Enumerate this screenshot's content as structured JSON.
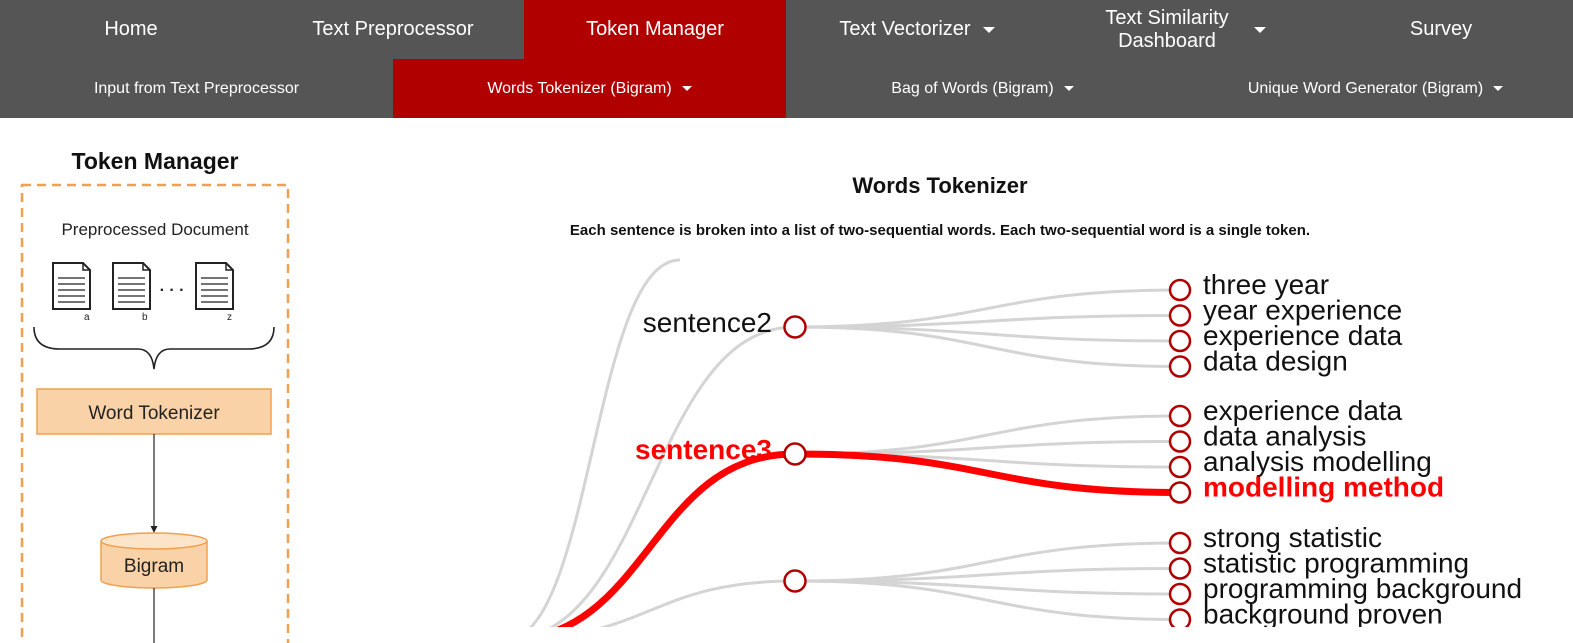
{
  "topnav": [
    {
      "label": "Home",
      "dropdown": false,
      "active": false
    },
    {
      "label": "Text Preprocessor",
      "dropdown": false,
      "active": false
    },
    {
      "label": "Token Manager",
      "dropdown": false,
      "active": true
    },
    {
      "label": "Text Vectorizer",
      "dropdown": true,
      "active": false
    },
    {
      "label": "Text Similarity Dashboard",
      "dropdown": true,
      "active": false
    },
    {
      "label": "Survey",
      "dropdown": false,
      "active": false
    }
  ],
  "subnav": [
    {
      "label": "Input from Text Preprocessor",
      "dropdown": false,
      "active": false
    },
    {
      "label": "Words Tokenizer (Bigram)",
      "dropdown": true,
      "active": true
    },
    {
      "label": "Bag of Words (Bigram)",
      "dropdown": true,
      "active": false
    },
    {
      "label": "Unique Word Generator (Bigram)",
      "dropdown": true,
      "active": false
    }
  ],
  "sidebar": {
    "title": "Token Manager",
    "doc_label": "Preprocessed Document",
    "doc_letters": [
      "a",
      "b",
      "z"
    ],
    "ellipsis": "· · ·",
    "step_label": "Word Tokenizer",
    "store_label": "Bigram"
  },
  "main": {
    "title": "Words Tokenizer",
    "description": "Each sentence is broken into a list of two-sequential words. Each two-sequential word is a single token."
  },
  "tree": {
    "highlight_color": "#ff0000",
    "node_color": "#b00000",
    "link_color": "#d4d4d4",
    "sentences": [
      {
        "label": "sentence2",
        "highlighted": false,
        "tokens": [
          {
            "label": "three year",
            "highlighted": false
          },
          {
            "label": "year experience",
            "highlighted": false
          },
          {
            "label": "experience data",
            "highlighted": false
          },
          {
            "label": "data design",
            "highlighted": false
          }
        ]
      },
      {
        "label": "sentence3",
        "highlighted": true,
        "tokens": [
          {
            "label": "experience data",
            "highlighted": false
          },
          {
            "label": "data analysis",
            "highlighted": false
          },
          {
            "label": "analysis modelling",
            "highlighted": false
          },
          {
            "label": "modelling method",
            "highlighted": true
          }
        ]
      },
      {
        "label": "",
        "highlighted": false,
        "tokens": [
          {
            "label": "strong statistic",
            "highlighted": false
          },
          {
            "label": "statistic programming",
            "highlighted": false
          },
          {
            "label": "programming background",
            "highlighted": false
          },
          {
            "label": "background proven",
            "highlighted": false
          }
        ]
      }
    ]
  }
}
